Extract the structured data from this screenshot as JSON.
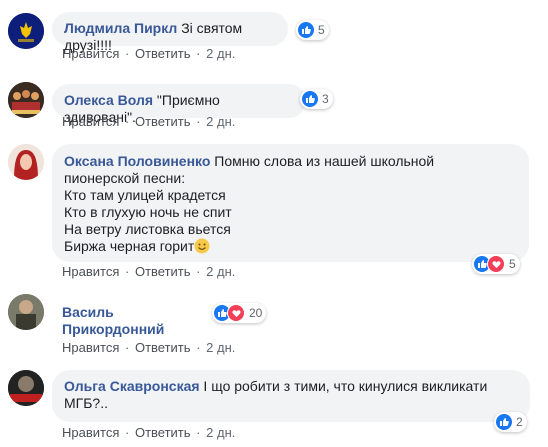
{
  "colors": {
    "author": "#385898",
    "bubble": "#f2f3f5",
    "like": "#1877f2",
    "love": "#f33e58"
  },
  "actions": {
    "like": "Нравится",
    "reply": "Ответить",
    "separator": "·"
  },
  "comments": [
    {
      "author": "Людмила Пиркл",
      "lines": [
        "Зі святом друзі!!!!"
      ],
      "time": "2 дн.",
      "reactions": {
        "types": [
          "like"
        ],
        "count": "5"
      }
    },
    {
      "author": "Олекса Воля",
      "lines": [
        "\"Приємно здивовані\"."
      ],
      "time": "2 дн.",
      "reactions": {
        "types": [
          "like"
        ],
        "count": "3"
      }
    },
    {
      "author": "Оксана Половиненко",
      "lines": [
        "Помню слова из нашей школьной",
        "пионерской песни:",
        "Кто там улицей крадется",
        "Кто в глухую ночь не спит",
        "На ветру листовка вьется",
        "Биржа черная горит"
      ],
      "time": "2 дн.",
      "reactions": {
        "types": [
          "like",
          "love"
        ],
        "count": "5"
      }
    },
    {
      "author": "Василь Прикордонний",
      "lines": [
        ""
      ],
      "time": "2 дн.",
      "reactions": {
        "types": [
          "like",
          "love"
        ],
        "count": "20"
      }
    },
    {
      "author": "Ольга Скавронская",
      "lines": [
        "І що робити з тими, что кинулися викликати",
        "МГБ?.."
      ],
      "time": "2 дн.",
      "reactions": {
        "types": [
          "like"
        ],
        "count": "2"
      }
    }
  ]
}
